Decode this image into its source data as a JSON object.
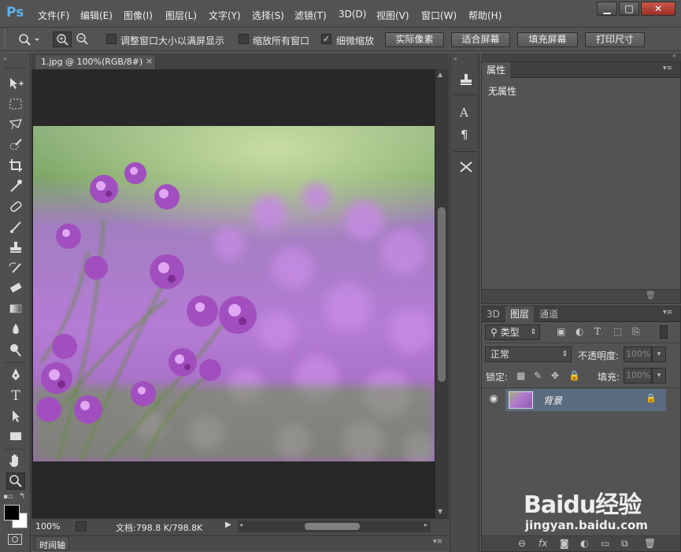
{
  "app": {
    "logo": "Ps"
  },
  "menu": [
    "文件(F)",
    "编辑(E)",
    "图像(I)",
    "图层(L)",
    "文字(Y)",
    "选择(S)",
    "滤镜(T)",
    "3D(D)",
    "视图(V)",
    "窗口(W)",
    "帮助(H)"
  ],
  "window_controls": {
    "minimize": "▁",
    "maximize": "□",
    "close": "✕"
  },
  "options": {
    "checkboxes": [
      {
        "label": "调整窗口大小以满屏显示",
        "checked": false
      },
      {
        "label": "缩放所有窗口",
        "checked": false
      },
      {
        "label": "细微缩放",
        "checked": true
      }
    ],
    "buttons": [
      "实际像素",
      "适合屏幕",
      "填充屏幕",
      "打印尺寸"
    ]
  },
  "document": {
    "tab_title": "1.jpg @ 100%(RGB/8#)",
    "tab_close": "×",
    "zoom": "100%",
    "status": "文档:798.8 K/798.8K"
  },
  "timeline": {
    "label": "时间轴"
  },
  "properties": {
    "tab": "属性",
    "content": "无属性"
  },
  "layers": {
    "tabs": [
      "3D",
      "图层",
      "通道"
    ],
    "filter_kind": "类型",
    "blend_mode": "正常",
    "opacity_label": "不透明度:",
    "opacity_value": "100%",
    "lock_label": "锁定:",
    "fill_label": "填充:",
    "fill_value": "100%",
    "items": [
      {
        "name": "背景",
        "locked": true,
        "visible": true
      }
    ]
  },
  "watermark": {
    "brand": "Baidu经验",
    "url": "jingyan.baidu.com"
  },
  "colors": {
    "accent": "#5fb0ea",
    "layer_selected": "#5c6c80"
  }
}
